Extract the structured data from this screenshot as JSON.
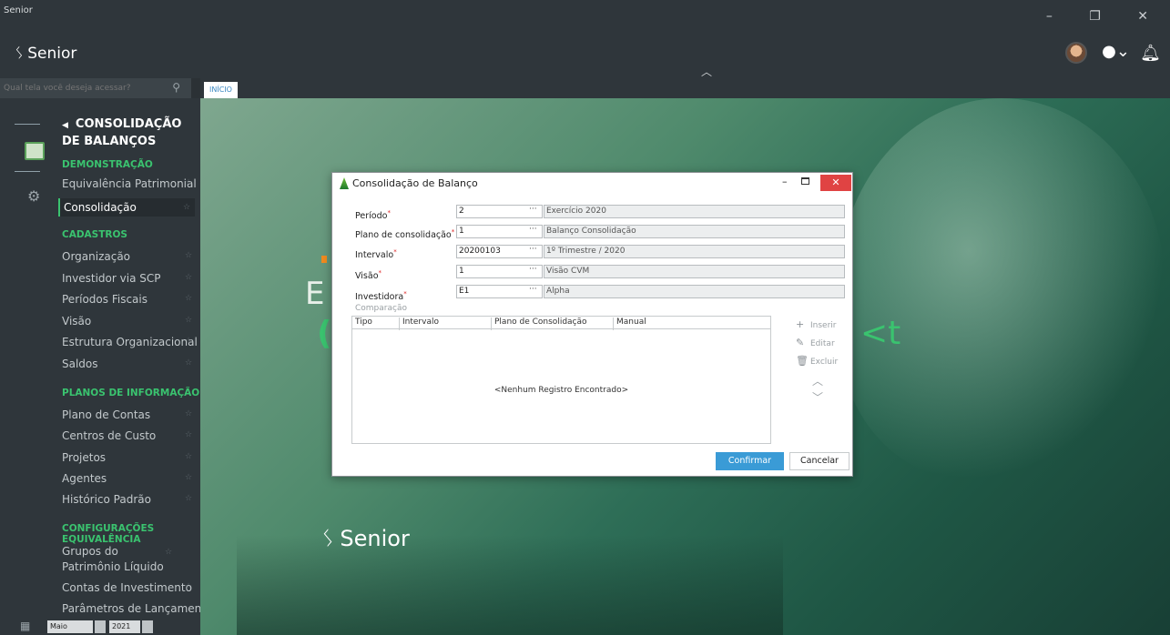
{
  "titlebar": {
    "app_name": "Senior",
    "window_controls": "– ❐ ✕"
  },
  "header": {
    "logo_text": "Senior",
    "logo_mark": "ʖ"
  },
  "search": {
    "placeholder": "Qual tela você deseja acessar?"
  },
  "tabs": [
    {
      "label": "INÍCIO"
    }
  ],
  "menu": {
    "title": "CONSOLIDAÇÃO DE BALANÇOS",
    "sections": [
      {
        "label": "DEMONSTRAÇÃO",
        "items": [
          "Equivalência Patrimonial",
          "Consolidação"
        ]
      },
      {
        "label": "CADASTROS",
        "items": [
          "Organização",
          "Investidor via SCP",
          "Períodos Fiscais",
          "Visão",
          "Estrutura Organizacional",
          "Saldos"
        ]
      },
      {
        "label": "PLANOS DE INFORMAÇÃO",
        "items": [
          "Plano de Contas",
          "Centros de Custo",
          "Projetos",
          "Agentes",
          "Histórico Padrão"
        ]
      },
      {
        "label": "CONFIGURAÇÕES EQUIVALÊNCIA",
        "items": [
          "Grupos do Patrimônio Líquido",
          "Contas de Investimento",
          "Parâmetros de Lançamentos"
        ]
      }
    ],
    "active_item": "Consolidação"
  },
  "bottombar": {
    "month": "Maio",
    "year": "2021"
  },
  "background": {
    "brand_text": "Senior",
    "word_b": "E",
    "word_c": "(",
    "word_xt": "<t"
  },
  "dialog": {
    "title": "Consolidação de Balanço",
    "fields": [
      {
        "label": "Período",
        "code": "2",
        "desc": "Exercício 2020"
      },
      {
        "label": "Plano de consolidação",
        "code": "1",
        "desc": "Balanço Consolidação"
      },
      {
        "label": "Intervalo",
        "code": "20200103",
        "desc": "1º Trimestre / 2020"
      },
      {
        "label": "Visão",
        "code": "1",
        "desc": "Visão CVM"
      },
      {
        "label": "Investidora",
        "code": "E1",
        "desc": "Alpha"
      }
    ],
    "comparison_label": "Comparação",
    "columns": [
      "Tipo",
      "Intervalo",
      "Plano de Consolidação",
      "Manual"
    ],
    "empty_message": "<Nenhum Registro Encontrado>",
    "actions": {
      "insert": "Inserir",
      "edit": "Editar",
      "delete": "Excluir"
    },
    "confirm": "Confirmar",
    "cancel": "Cancelar"
  },
  "colors": {
    "accent": "#3ac36f",
    "primary_button": "#3a9bd6",
    "close_button": "#e04343",
    "sidebar": "#2f363b"
  }
}
